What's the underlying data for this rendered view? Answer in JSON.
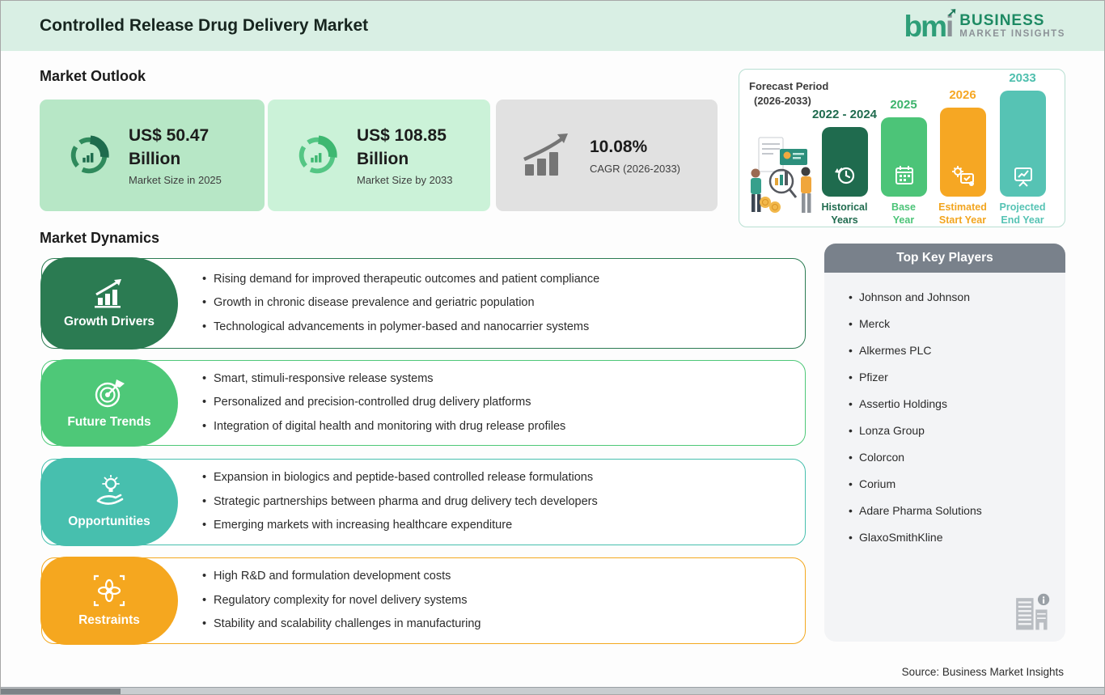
{
  "header": {
    "title": "Controlled Release Drug Delivery Market",
    "logo": {
      "mark_bm": "bm",
      "mark_i": "i",
      "arrow": "➚",
      "line1": "BUSINESS",
      "line2": "MARKET INSIGHTS"
    }
  },
  "market_outlook": {
    "heading": "Market Outlook",
    "cards": [
      {
        "icon": "donut-chart-icon",
        "value_line1": "US$ 50.47",
        "value_line2": "Billion",
        "label": "Market Size in 2025",
        "bg_color": "#b7e7c6"
      },
      {
        "icon": "donut-chart-icon",
        "value_line1": "US$ 108.85",
        "value_line2": "Billion",
        "label": "Market Size by 2033",
        "bg_color": "#cbf2d8"
      },
      {
        "icon": "bar-growth-arrow-icon",
        "value_line1": "10.08%",
        "value_line2": "",
        "label": "CAGR (2026-2033)",
        "bg_color": "#e1e1e1"
      }
    ]
  },
  "forecast": {
    "title_line1": "Forecast Period",
    "title_line2": "(2026-2033)",
    "illustration": "market-research-illustration",
    "bars": [
      {
        "year": "2022 - 2024",
        "label_line1": "Historical",
        "label_line2": "Years",
        "icon": "history-clock-icon",
        "color": "#1f6b4e"
      },
      {
        "year": "2025",
        "label_line1": "Base",
        "label_line2": "Year",
        "icon": "calendar-icon",
        "color": "#4cc478"
      },
      {
        "year": "2026",
        "label_line1": "Estimated",
        "label_line2": "Start Year",
        "icon": "automation-gear-icon",
        "color": "#f6a723"
      },
      {
        "year": "2033",
        "label_line1": "Projected",
        "label_line2": "End Year",
        "icon": "presentation-board-icon",
        "color": "#56c3b4"
      }
    ]
  },
  "market_dynamics": {
    "heading": "Market Dynamics",
    "rows": [
      {
        "title": "Growth Drivers",
        "icon": "growth-chart-icon",
        "color": "#2b7b52",
        "bullets": [
          "Rising demand for improved therapeutic outcomes and patient compliance",
          "Growth in chronic disease prevalence and geriatric population",
          "Technological advancements in polymer-based and nanocarrier systems"
        ]
      },
      {
        "title": "Future Trends",
        "icon": "target-dart-icon",
        "color": "#4ec878",
        "bullets": [
          "Smart, stimuli-responsive release systems",
          "Personalized and precision-controlled drug delivery platforms",
          "Integration of digital health and monitoring with drug release profiles"
        ]
      },
      {
        "title": "Opportunities",
        "icon": "idea-hand-icon",
        "color": "#47bfae",
        "bullets": [
          "Expansion in biologics and peptide-based controlled release formulations",
          "Strategic partnerships between pharma and drug delivery tech developers",
          "Emerging markets with increasing healthcare expenditure"
        ]
      },
      {
        "title": "Restraints",
        "icon": "constraint-knot-icon",
        "color": "#f5a71f",
        "bullets": [
          "High R&D and formulation development costs",
          "Regulatory complexity for novel delivery systems",
          "Stability and scalability challenges in manufacturing"
        ]
      }
    ]
  },
  "key_players": {
    "heading": "Top Key Players",
    "icon": "company-building-icon",
    "players": [
      "Johnson and Johnson",
      "Merck",
      "Alkermes PLC",
      "Pfizer",
      "Assertio Holdings",
      "Lonza Group",
      "Colorcon",
      "Corium",
      "Adare Pharma Solutions",
      "GlaxoSmithKline"
    ]
  },
  "footer": {
    "source": "Source: Business Market Insights"
  }
}
